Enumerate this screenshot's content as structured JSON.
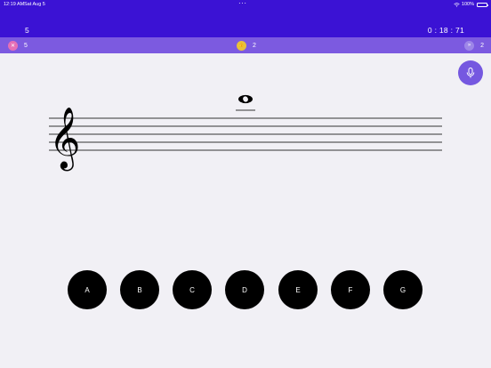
{
  "status_bar": {
    "time": "12:19 AM",
    "date": "Sat Aug 5",
    "battery": "100%"
  },
  "header": {
    "left_value": "5",
    "timer": "0 : 18 : 71"
  },
  "score_bar": {
    "wrong": {
      "icon": "x-icon",
      "symbol": "✕",
      "count": "5"
    },
    "correct": {
      "icon": "thumbs-up-icon",
      "symbol": "👍",
      "count": "2"
    },
    "skipped": {
      "icon": "skip-icon",
      "symbol": "»",
      "count": "2"
    }
  },
  "microphone": {
    "icon": "microphone-icon"
  },
  "staff": {
    "clef": "treble",
    "clef_glyph": "𝄞",
    "note": {
      "type": "whole",
      "ledger_lines_above": 1
    }
  },
  "note_buttons": [
    {
      "label": "A"
    },
    {
      "label": "B"
    },
    {
      "label": "C"
    },
    {
      "label": "D"
    },
    {
      "label": "E"
    },
    {
      "label": "F"
    },
    {
      "label": "G"
    }
  ],
  "colors": {
    "header": "#3b12d4",
    "score_bar": "#7c5ae0",
    "background": "#f1f0f5",
    "mic_button": "#7558e0",
    "wrong_badge": "#e56fb6",
    "correct_badge": "#e8c13a",
    "skipped_badge": "#9d86e8"
  }
}
